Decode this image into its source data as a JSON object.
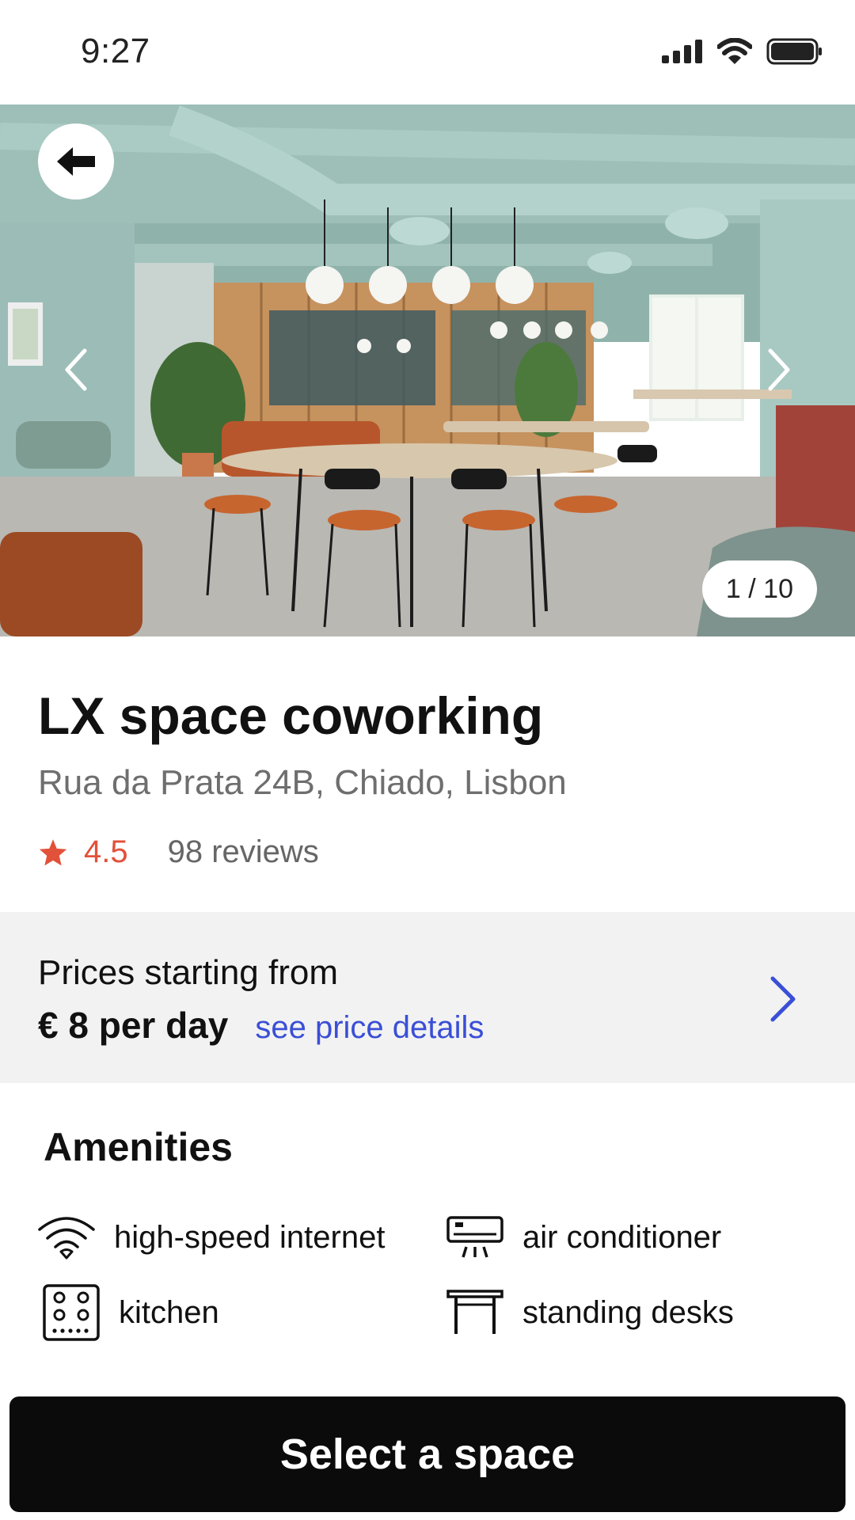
{
  "status_bar": {
    "time": "9:27"
  },
  "gallery": {
    "counter": "1 / 10"
  },
  "listing": {
    "name": "LX space coworking",
    "address": "Rua da Prata 24B, Chiado, Lisbon",
    "rating": "4.5",
    "reviews": "98 reviews"
  },
  "pricing": {
    "label": "Prices starting from",
    "price": "€ 8 per day",
    "details_link": "see price details"
  },
  "amenities": {
    "title": "Amenities",
    "items": [
      {
        "label": "high-speed internet",
        "icon": "wifi-icon"
      },
      {
        "label": "air conditioner",
        "icon": "air-conditioner-icon"
      },
      {
        "label": "kitchen",
        "icon": "stove-icon"
      },
      {
        "label": "standing desks",
        "icon": "desk-icon"
      }
    ]
  },
  "cta": {
    "label": "Select a space"
  },
  "colors": {
    "accent_link": "#3a4fd6",
    "rating": "#e2513a",
    "cta_bg": "#0b0b0b"
  }
}
